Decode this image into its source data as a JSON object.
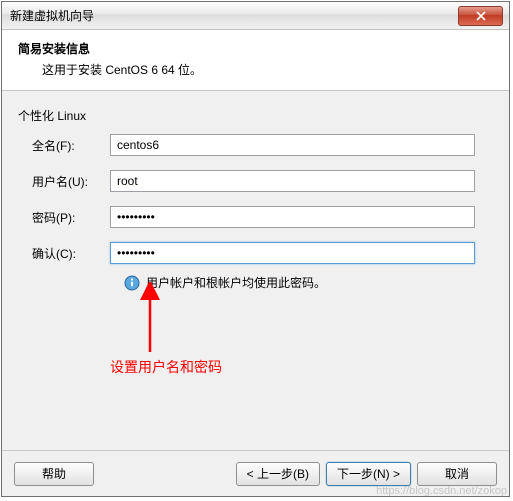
{
  "window": {
    "title": "新建虚拟机向导"
  },
  "header": {
    "title": "简易安装信息",
    "subtitle": "这用于安装 CentOS 6 64 位。"
  },
  "form": {
    "section_label": "个性化 Linux",
    "fullname_label": "全名(F):",
    "fullname_value": "centos6",
    "username_label": "用户名(U):",
    "username_value": "root",
    "password_label": "密码(P):",
    "password_value": "•••••••••",
    "confirm_label": "确认(C):",
    "confirm_value": "•••••••••",
    "hint": "用户帐户和根帐户均使用此密码。"
  },
  "footer": {
    "help": "帮助",
    "back": "< 上一步(B)",
    "next": "下一步(N) >",
    "cancel": "取消"
  },
  "annotation": {
    "text": "设置用户名和密码"
  },
  "watermark": "https://blog.csdn.net/zokop"
}
